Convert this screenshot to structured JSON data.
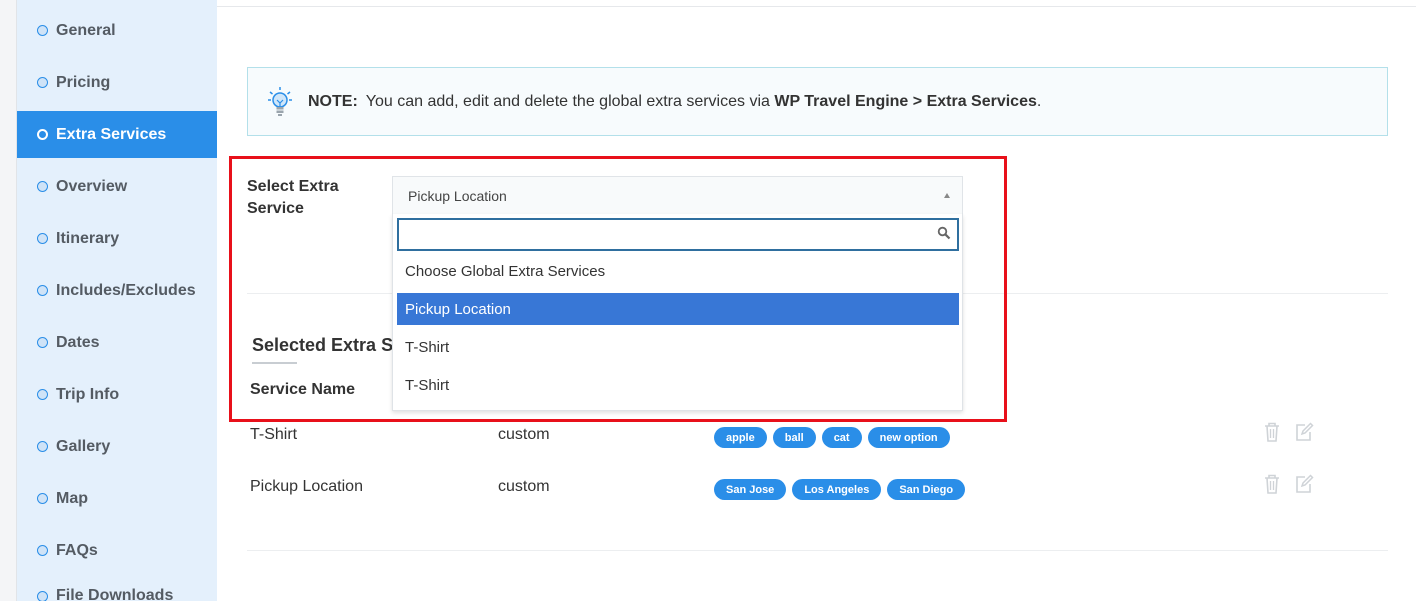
{
  "sidebar": {
    "items": [
      {
        "label": "General",
        "active": false
      },
      {
        "label": "Pricing",
        "active": false
      },
      {
        "label": "Extra Services",
        "active": true
      },
      {
        "label": "Overview",
        "active": false
      },
      {
        "label": "Itinerary",
        "active": false
      },
      {
        "label": "Includes/Excludes",
        "active": false
      },
      {
        "label": "Dates",
        "active": false
      },
      {
        "label": "Trip Info",
        "active": false
      },
      {
        "label": "Gallery",
        "active": false
      },
      {
        "label": "Map",
        "active": false
      },
      {
        "label": "FAQs",
        "active": false
      },
      {
        "label": "File Downloads",
        "active": false
      }
    ]
  },
  "note": {
    "label": "NOTE:",
    "text_before": "You can add, edit and delete the global extra services via ",
    "link_text": "WP Travel Engine > Extra Services",
    "text_after": "."
  },
  "select": {
    "label": "Select Extra Service",
    "current_value": "Pickup Location",
    "search_value": "",
    "search_placeholder": "",
    "options": [
      {
        "label": "Choose Global Extra Services",
        "selected": false
      },
      {
        "label": "Pickup Location",
        "selected": true
      },
      {
        "label": "T-Shirt",
        "selected": false
      },
      {
        "label": "T-Shirt",
        "selected": false
      }
    ]
  },
  "selected_services": {
    "title": "Selected Extra Services",
    "column_service_name": "Service Name",
    "rows": [
      {
        "name": "T-Shirt",
        "type": "custom",
        "tags": [
          "apple",
          "ball",
          "cat",
          "new option"
        ]
      },
      {
        "name": "Pickup Location",
        "type": "custom",
        "tags": [
          "San Jose",
          "Los Angeles",
          "San Diego"
        ]
      }
    ]
  },
  "colors": {
    "accent": "#2a8ee8",
    "option_highlight": "#3877d6",
    "highlight_frame": "#e8101a",
    "sidebar_bg": "#e4f0fc"
  },
  "icons": {
    "note": "lightbulb-icon",
    "search": "search-icon",
    "delete": "trash-icon",
    "edit": "edit-icon"
  }
}
